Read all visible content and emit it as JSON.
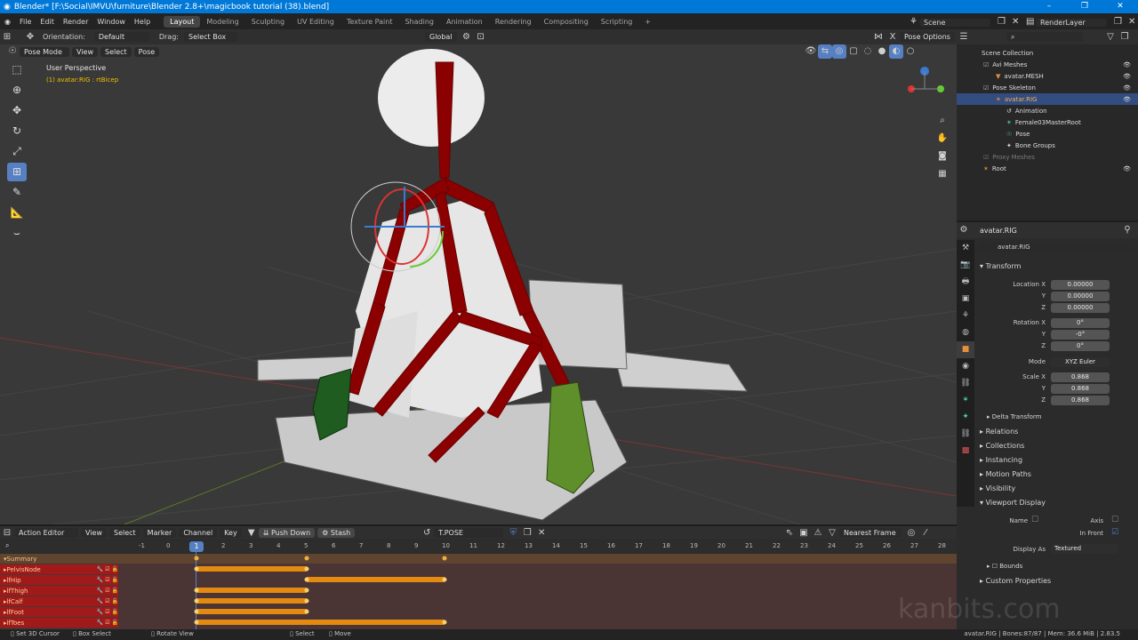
{
  "window": {
    "title": "Blender* [F:\\Social\\IMVU\\furniture\\Blender 2.8+\\magicbook tutorial (38).blend]",
    "controls": [
      "–",
      "❐",
      "✕"
    ]
  },
  "menu": {
    "items": [
      "File",
      "Edit",
      "Render",
      "Window",
      "Help"
    ],
    "workspaces": [
      "Layout",
      "Modeling",
      "Sculpting",
      "UV Editing",
      "Texture Paint",
      "Shading",
      "Animation",
      "Rendering",
      "Compositing",
      "Scripting"
    ],
    "add": "+",
    "scene": "Scene",
    "layer": "RenderLayer"
  },
  "viewport": {
    "header1": {
      "orientation_label": "Orientation:",
      "orientation_value": "Default",
      "drag_label": "Drag:",
      "drag_value": "Select Box",
      "pivot": "Global",
      "pose_options": "Pose Options"
    },
    "header2": {
      "mode": "Pose Mode",
      "menus": [
        "View",
        "Select",
        "Pose"
      ]
    },
    "overlay_title": "User Perspective",
    "overlay_sub": "(1) avatar:RIG : rtBicep",
    "gizmo_labels": [
      "Y",
      "Z",
      "X"
    ]
  },
  "outliner": {
    "search_placeholder": "",
    "items": [
      {
        "label": "Scene Collection",
        "depth": 0
      },
      {
        "label": "Avi Meshes",
        "depth": 1
      },
      {
        "label": "avatar.MESH",
        "depth": 2
      },
      {
        "label": "Pose Skeleton",
        "depth": 1
      },
      {
        "label": "avatar.RIG",
        "depth": 2,
        "selected": true
      },
      {
        "label": "Animation",
        "depth": 3
      },
      {
        "label": "Female03MasterRoot",
        "depth": 3
      },
      {
        "label": "Pose",
        "depth": 3
      },
      {
        "label": "Bone Groups",
        "depth": 3
      },
      {
        "label": "Proxy Meshes",
        "depth": 1,
        "dim": true
      },
      {
        "label": "Root",
        "depth": 1
      }
    ]
  },
  "properties": {
    "context": "avatar.RIG",
    "object_name": "avatar.RIG",
    "transform_header": "Transform",
    "location": {
      "label": "Location X",
      "y_label": "Y",
      "z_label": "Z",
      "x": "0.00000",
      "y": "0.00000",
      "z": "0.00000"
    },
    "rotation": {
      "label": "Rotation X",
      "y_label": "Y",
      "z_label": "Z",
      "x": "0°",
      "y": "-0°",
      "z": "0°"
    },
    "mode": {
      "label": "Mode",
      "value": "XYZ Euler"
    },
    "scale": {
      "label": "Scale X",
      "y_label": "Y",
      "z_label": "Z",
      "x": "0.868",
      "y": "0.868",
      "z": "0.868"
    },
    "delta": "Delta Transform",
    "sections": [
      "Relations",
      "Collections",
      "Instancing",
      "Motion Paths",
      "Visibility"
    ],
    "viewport_display": "Viewport Display",
    "name_label": "Name",
    "axis_label": "Axis",
    "infront_label": "In Front",
    "display_as_label": "Display As",
    "display_as": "Textured",
    "bounds": "Bounds",
    "custom_props": "Custom Properties"
  },
  "timeline": {
    "editor": "Action Editor",
    "menus": [
      "View",
      "Select",
      "Marker",
      "Channel",
      "Key"
    ],
    "push_down": "Push Down",
    "stash": "Stash",
    "action": "T.POSE",
    "snap": "Nearest Frame",
    "ticks": [
      "-1",
      "0",
      "1",
      "2",
      "3",
      "4",
      "5",
      "6",
      "7",
      "8",
      "9",
      "10",
      "11",
      "12",
      "13",
      "14",
      "15",
      "16",
      "17",
      "18",
      "19",
      "20",
      "21",
      "22",
      "23",
      "24",
      "25",
      "26",
      "27",
      "28"
    ],
    "current_frame": "1",
    "summary": "Summary",
    "channels": [
      "PelvisNode",
      "lfHip",
      "lfThigh",
      "lfCalf",
      "lfFoot",
      "lfToes"
    ]
  },
  "status": {
    "left": [
      "Set 3D Cursor",
      "Box Select",
      "Rotate View",
      "Select",
      "Move"
    ],
    "right": "avatar.RIG | Bones:87/87 | Mem: 36.6 MiB | 2.83.5"
  },
  "watermark": "kanbits.com",
  "colors": {
    "accent": "#5680c2",
    "channel_red": "#a11a1a",
    "key_orange": "#e48a10",
    "bone_red": "#8b0000",
    "bone_green": "#1f5c1f"
  }
}
